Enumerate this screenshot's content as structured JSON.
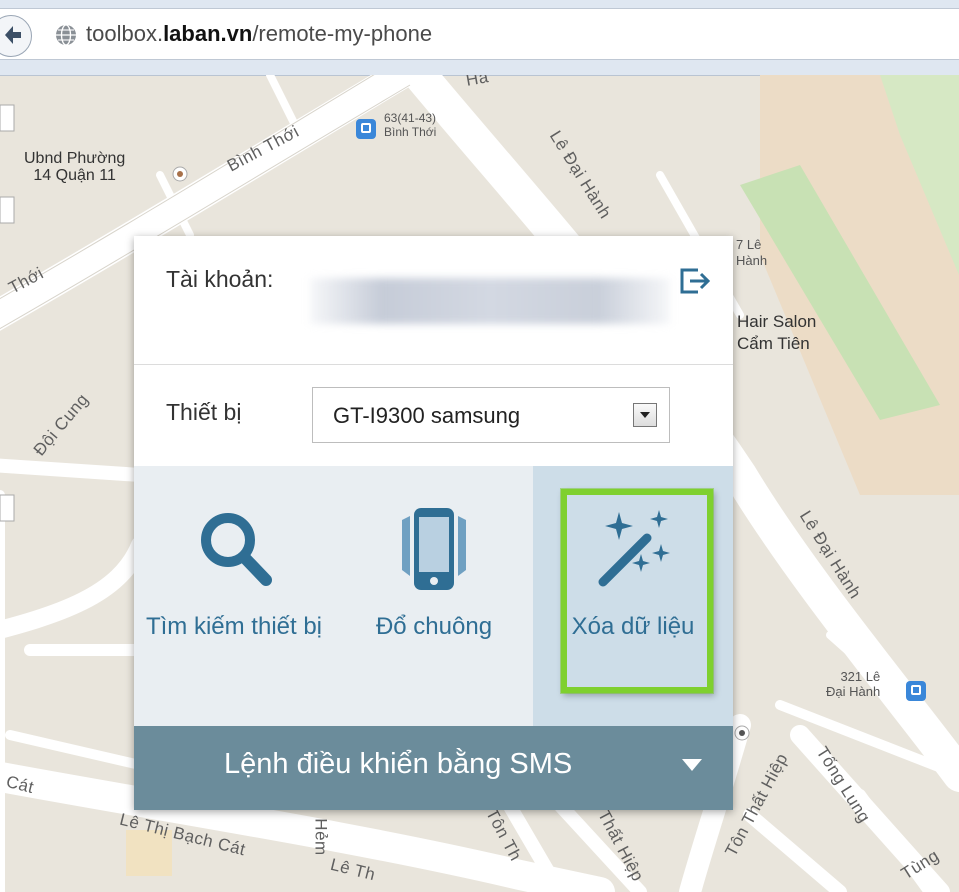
{
  "browser": {
    "url_prefix": "toolbox.",
    "url_domain": "laban.vn",
    "url_path": "/remote-my-phone"
  },
  "map": {
    "streets": [
      "Bình Thới",
      "Lê Đại Hành",
      "Đội Cung",
      "Lê Đại Hành",
      "Tống Lung",
      "Lê Thị Bạch Cát",
      "Tôn Thất Hiệp",
      "Tôn Thất Hiệp",
      "Tôn Th",
      "Hẻm",
      "Thới",
      "Cát",
      "Tùng",
      "Hà",
      "Lê Th"
    ],
    "pois": {
      "ubnd": "Ubnd Phường\n14 Quận 11",
      "bus_stop_1": "63(41-43)\nBình Thới",
      "le_hanh": "7 Lê\nHành",
      "hair_salon": "Hair Salon\nCẩm Tiên",
      "bus_stop_2": "321 Lê\nĐại Hành"
    }
  },
  "panel": {
    "account_label": "Tài khoản:",
    "device_label": "Thiết bị",
    "device_selected": "GT-I9300 samsung",
    "actions": [
      {
        "label": "Tìm kiếm thiết bị",
        "icon": "search-icon"
      },
      {
        "label": "Đổ chuông",
        "icon": "phone-ring-icon"
      },
      {
        "label": "Xóa dữ liệu",
        "icon": "magic-wand-icon"
      }
    ],
    "sms_label": "Lệnh điều khiển bằng SMS"
  },
  "colors": {
    "accent_blue": "#2f6e94",
    "sms_bar": "#6b8c9b",
    "highlight": "#7fd02f",
    "active_bg": "#cddde8"
  }
}
